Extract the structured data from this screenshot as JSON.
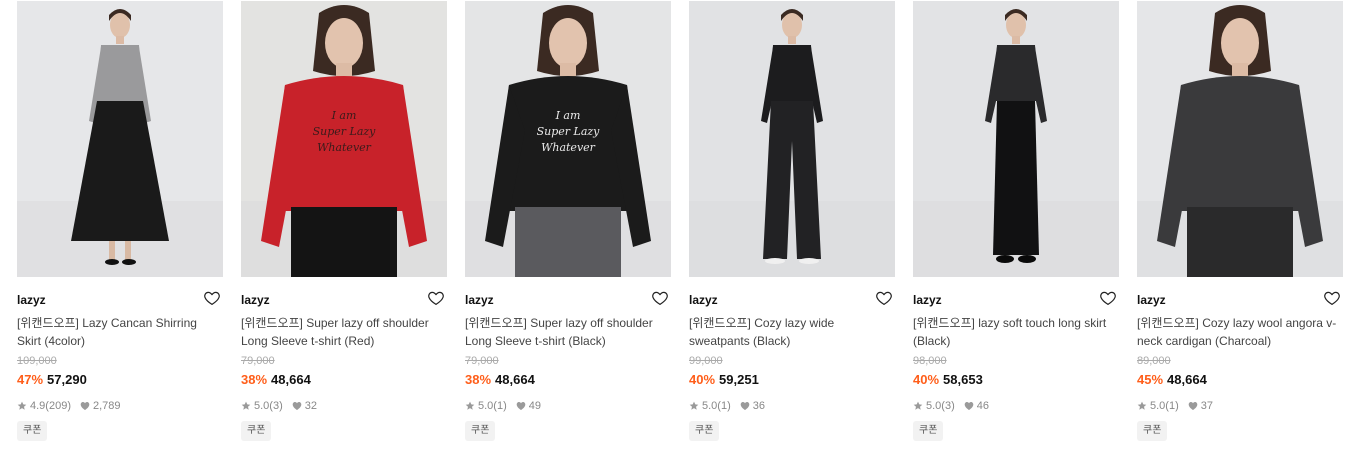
{
  "products": [
    {
      "brand": "lazyz",
      "title": "[위캔드오프] Lazy Cancan Shirring Skirt (4color)",
      "original_price": "109,000",
      "discount": "47%",
      "price": "57,290",
      "rating": "4.9",
      "reviews": "(209)",
      "likes": "2,789",
      "coupon": "쿠폰",
      "image": {
        "top": "#9a9a9c",
        "bottom": "#1a1a1a",
        "bg": "#e6e7e9",
        "text": ""
      }
    },
    {
      "brand": "lazyz",
      "title": "[위캔드오프] Super lazy off shoulder Long Sleeve t-shirt (Red)",
      "original_price": "79,000",
      "discount": "38%",
      "price": "48,664",
      "rating": "5.0",
      "reviews": "(3)",
      "likes": "32",
      "coupon": "쿠폰",
      "image": {
        "top": "#c8222a",
        "bottom": "#141414",
        "bg": "#e3e3e1",
        "text": "I am Super Lazy Whatever"
      }
    },
    {
      "brand": "lazyz",
      "title": "[위캔드오프] Super lazy off shoulder Long Sleeve t-shirt (Black)",
      "original_price": "79,000",
      "discount": "38%",
      "price": "48,664",
      "rating": "5.0",
      "reviews": "(1)",
      "likes": "49",
      "coupon": "쿠폰",
      "image": {
        "top": "#1b1b1b",
        "bottom": "#5a5a5e",
        "bg": "#e4e5e6",
        "text": "I am Super Lazy Whatever"
      }
    },
    {
      "brand": "lazyz",
      "title": "[위캔드오프] Cozy lazy wide sweatpants (Black)",
      "original_price": "99,000",
      "discount": "40%",
      "price": "59,251",
      "rating": "5.0",
      "reviews": "(1)",
      "likes": "36",
      "coupon": "쿠폰",
      "image": {
        "top": "#1c1c1e",
        "bottom": "#222224",
        "bg": "#e1e2e4",
        "text": ""
      }
    },
    {
      "brand": "lazyz",
      "title": "[위캔드오프] lazy soft touch long skirt (Black)",
      "original_price": "98,000",
      "discount": "40%",
      "price": "58,653",
      "rating": "5.0",
      "reviews": "(3)",
      "likes": "46",
      "coupon": "쿠폰",
      "image": {
        "top": "#2a2a2c",
        "bottom": "#111112",
        "bg": "#e2e3e5",
        "text": ""
      }
    },
    {
      "brand": "lazyz",
      "title": "[위캔드오프] Cozy lazy wool angora v-neck cardigan (Charcoal)",
      "original_price": "89,000",
      "discount": "45%",
      "price": "48,664",
      "rating": "5.0",
      "reviews": "(1)",
      "likes": "37",
      "coupon": "쿠폰",
      "image": {
        "top": "#3a3a3c",
        "bottom": "#2a2a2b",
        "bg": "#e5e6e8",
        "text": ""
      }
    }
  ],
  "icons": {
    "wishlist": "heart-outline-icon",
    "rating": "star-icon",
    "likes": "heart-filled-icon"
  },
  "colors": {
    "discount": "#ff5e1a",
    "strike": "#aaaaaa"
  }
}
